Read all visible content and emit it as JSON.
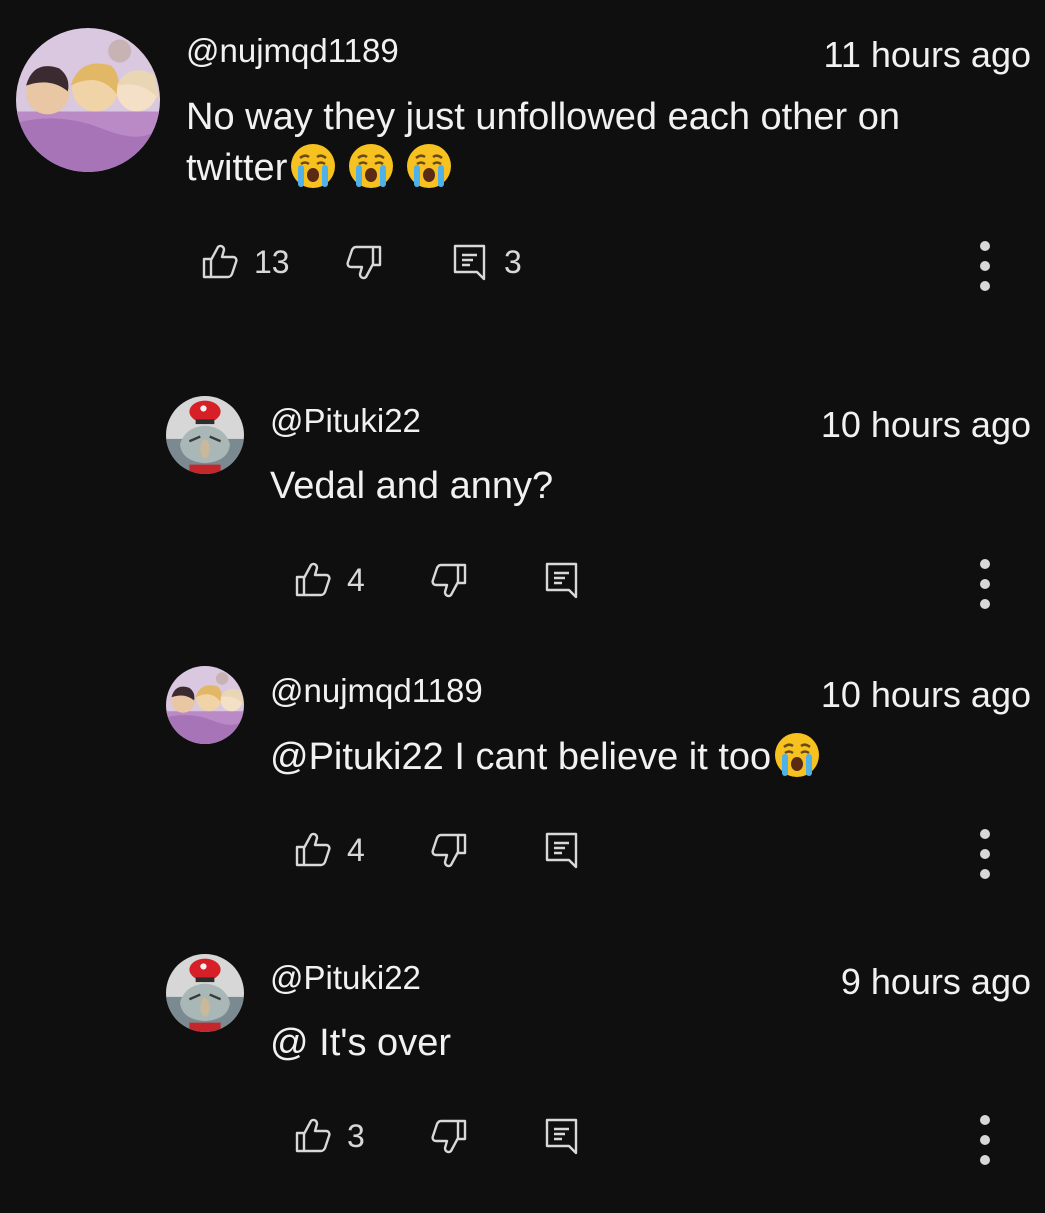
{
  "colors": {
    "background": "#0f0f0f",
    "text": "#f1f1f1",
    "icon": "#d8d8d8"
  },
  "comments": [
    {
      "author": "@nujmqd1189",
      "time": "11 hours ago",
      "text_line1": "No way they just unfollowed each other on",
      "text_line2": "twitter",
      "emojis": [
        "loudly-crying-face",
        "loudly-crying-face",
        "loudly-crying-face"
      ],
      "likes": "13",
      "replies": "3",
      "avatar": "anime-group-avatar"
    },
    {
      "author": "@Pituki22",
      "time": "10 hours ago",
      "text": "Vedal and anny?",
      "likes": "4",
      "avatar": "red-hat-character-avatar"
    },
    {
      "author": "@nujmqd1189",
      "time": "10 hours ago",
      "text": "@Pituki22 I cant believe it too",
      "emojis": [
        "loudly-crying-face"
      ],
      "likes": "4",
      "avatar": "anime-group-avatar"
    },
    {
      "author": "@Pituki22",
      "time": "9 hours ago",
      "text": "@ It's over",
      "likes": "3",
      "avatar": "red-hat-character-avatar"
    }
  ]
}
